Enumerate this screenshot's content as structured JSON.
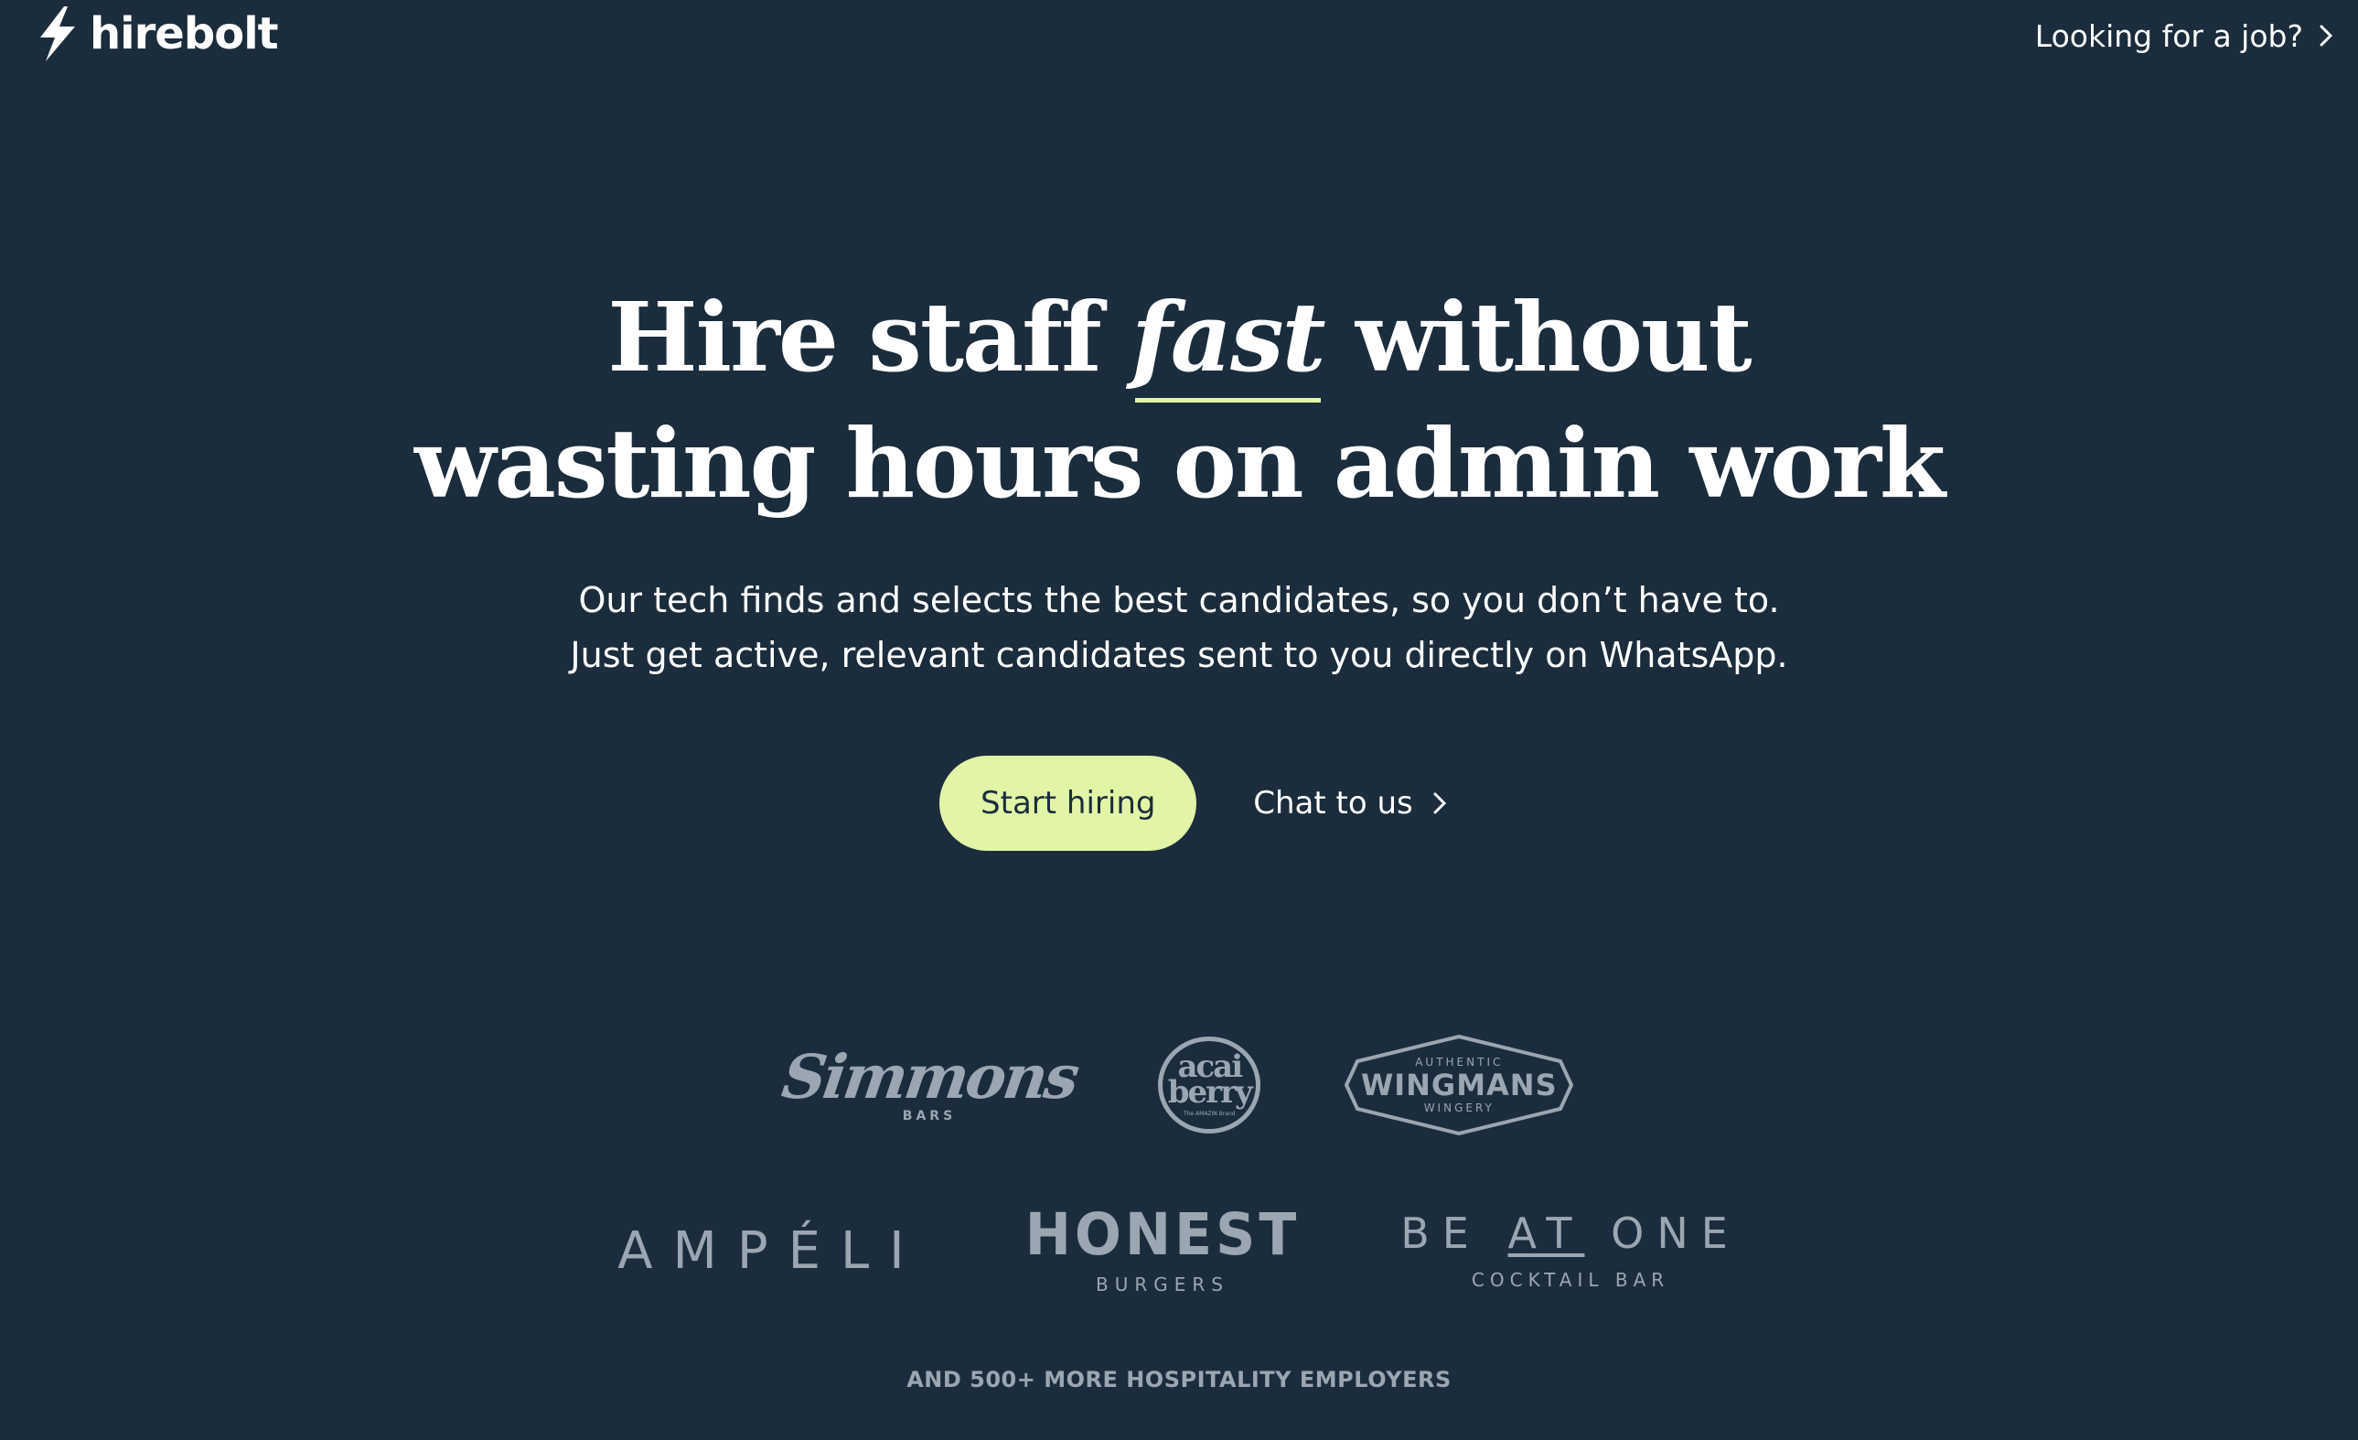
{
  "brand": {
    "name": "hirebolt",
    "logo_icon": "lightning-bolt-icon"
  },
  "header": {
    "job_link_label": "Looking for a job?",
    "job_link_icon": "chevron-right-icon"
  },
  "hero": {
    "headline_before": "Hire staff",
    "headline_accent": "fast",
    "headline_after": "without",
    "headline_line2": "wasting hours on admin work",
    "subtitle_line1": "Our tech finds and selects the best candidates, so you don’t have to.",
    "subtitle_line2": "Just get active, relevant candidates sent to you directly on WhatsApp.",
    "primary_cta": "Start hiring",
    "secondary_cta": "Chat to us"
  },
  "employers": {
    "logos": [
      {
        "name": "Simmons",
        "sub": "BARS"
      },
      {
        "name_top": "acai",
        "name_bottom": "berry",
        "sub": "The AMAZIN Brand"
      },
      {
        "top": "AUTHENTIC",
        "name": "WINGMANS",
        "sub": "WINGERY"
      },
      {
        "name": "AMPÉLI"
      },
      {
        "name": "HONEST",
        "sub": "BURGERS"
      },
      {
        "name_a": "BE",
        "name_b": "AT",
        "name_c": "ONE",
        "sub": "COCKTAIL BAR"
      }
    ],
    "footnote": "AND 500+ MORE HOSPITALITY EMPLOYERS"
  },
  "colors": {
    "background": "#1b2d3c",
    "accent": "#e2f5a7",
    "text": "#ffffff",
    "muted": "#9aa6b1"
  }
}
